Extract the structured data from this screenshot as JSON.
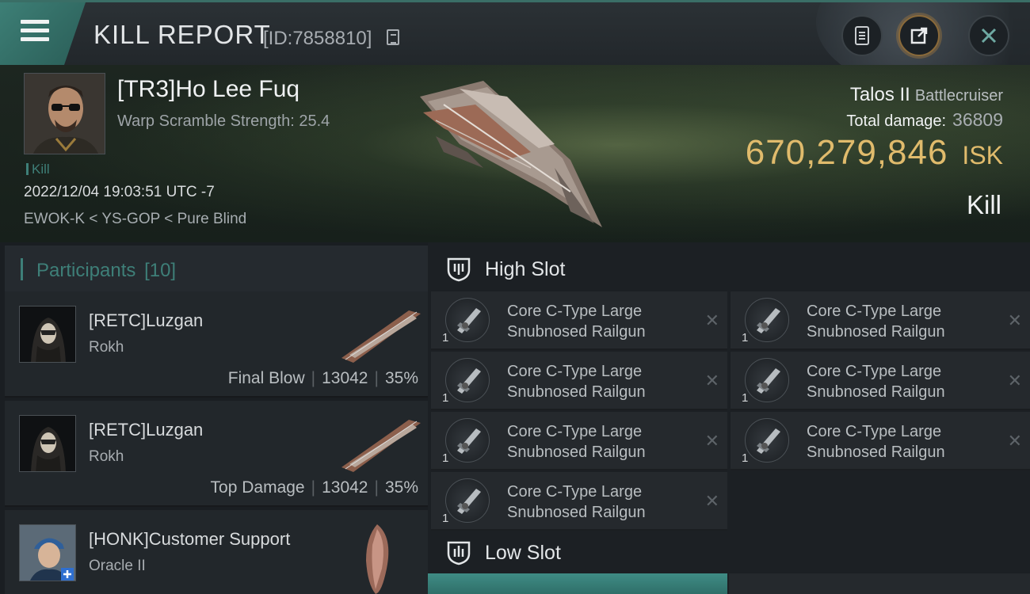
{
  "header": {
    "title": "KILL REPORT",
    "report_id": "[ID:7858810]",
    "menu_icon": "hamburger-menu-icon",
    "buttons": [
      "clipboard-icon",
      "share-icon",
      "close-icon"
    ]
  },
  "victim": {
    "name": "[TR3]Ho Lee Fuq",
    "scramble": "Warp Scramble Strength: 25.4",
    "tag": "Kill",
    "datetime": "2022/12/04 19:03:51 UTC -7",
    "location": "EWOK-K < YS-GOP < Pure Blind",
    "ship_name": "Talos II",
    "ship_class": "Battlecruiser",
    "total_damage_label": "Total damage:",
    "total_damage": "36809",
    "isk_value": "670,279,846",
    "isk_unit": "ISK",
    "kill_type": "Kill"
  },
  "participants": {
    "label": "Participants",
    "count": "[10]",
    "rows": [
      {
        "name": "[RETC]Luzgan",
        "ship": "Rokh",
        "role": "Final Blow",
        "damage": "13042",
        "percent": "35%"
      },
      {
        "name": "[RETC]Luzgan",
        "ship": "Rokh",
        "role": "Top Damage",
        "damage": "13042",
        "percent": "35%"
      },
      {
        "name": "[HONK]Customer Support",
        "ship": "Oracle II",
        "role": "",
        "damage": "",
        "percent": ""
      }
    ]
  },
  "fitting": {
    "high_slot_label": "High Slot",
    "low_slot_label": "Low Slot",
    "module_qty": "1",
    "module_line1": "Core C-Type Large",
    "module_line2": "Snubnosed Railgun",
    "close_glyph": "✕"
  },
  "colors": {
    "accent_teal": "#3e7f78",
    "isk_gold": "#e0bb6c"
  }
}
